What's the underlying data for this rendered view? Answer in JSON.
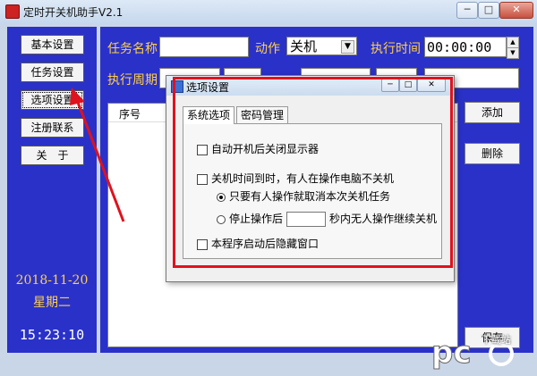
{
  "window": {
    "title": "定时开关机助手V2.1"
  },
  "sidebar": {
    "buttons": [
      {
        "label": "基本设置"
      },
      {
        "label": "任务设置"
      },
      {
        "label": "选项设置"
      },
      {
        "label": "注册联系"
      },
      {
        "label": "关　于"
      }
    ],
    "date": "2018-11-20",
    "weekday": "星期二",
    "time": "15:23:10"
  },
  "form": {
    "task_name_label": "任务名称",
    "task_name_value": "",
    "action_label": "动作",
    "action_value": "关机",
    "exec_time_label": "执行时间",
    "exec_time_value": "00:00:00",
    "period_label": "执行周期"
  },
  "task_list": {
    "columns": [
      "序号"
    ]
  },
  "side_actions": {
    "add_label": "添加",
    "delete_label": "删除",
    "save_label": "保存"
  },
  "dialog": {
    "title": "选项设置",
    "tabs": [
      {
        "label": "系统选项"
      },
      {
        "label": "密码管理"
      }
    ],
    "options": {
      "close_display": "自动开机后关闭显示器",
      "no_shutdown_if_busy": "关机时间到时，有人在操作电脑不关机",
      "radio_cancel": "只要有人操作就取消本次关机任务",
      "radio_stop_prefix": "停止操作后",
      "radio_stop_suffix": "秒内无人操作继续关机",
      "hide_window": "本程序启动后隐藏窗口"
    }
  },
  "watermark": {
    "text": "下载站"
  },
  "colors": {
    "panel_blue": "#2a31c9",
    "label_yellow": "#ffd04a",
    "highlight_red": "#e0121d"
  }
}
